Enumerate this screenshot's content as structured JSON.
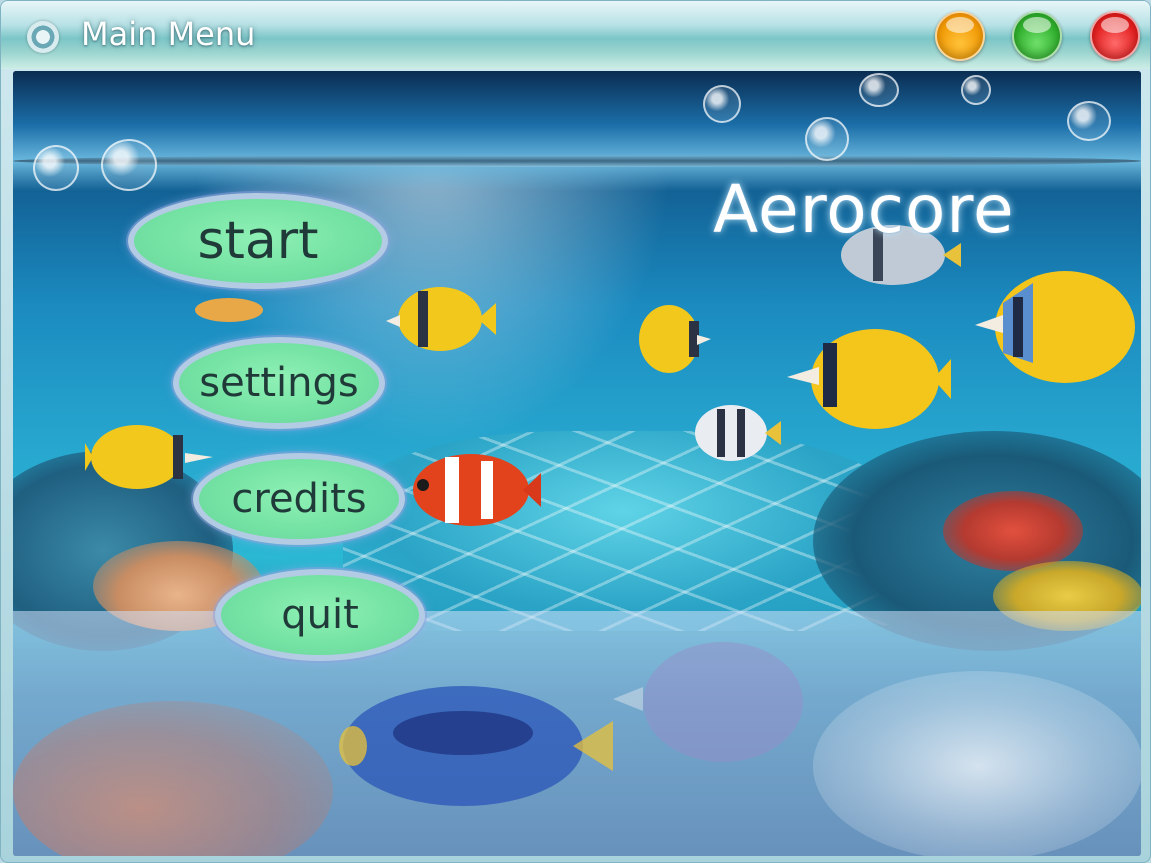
{
  "window": {
    "title": "Main Menu"
  },
  "game": {
    "title": "Aerocore"
  },
  "menu": {
    "start_label": "start",
    "settings_label": "settings",
    "credits_label": "credits",
    "quit_label": "quit"
  },
  "colors": {
    "menu_button_fill": "#74e3a3",
    "menu_button_border": "#bec8f0",
    "minimize": "#f29a05",
    "maximize": "#2fae2c",
    "close": "#e21f1f"
  },
  "icons": {
    "app": "app-orb-icon",
    "minimize": "minimize-orb-icon",
    "maximize": "maximize-orb-icon",
    "close": "close-orb-icon"
  }
}
